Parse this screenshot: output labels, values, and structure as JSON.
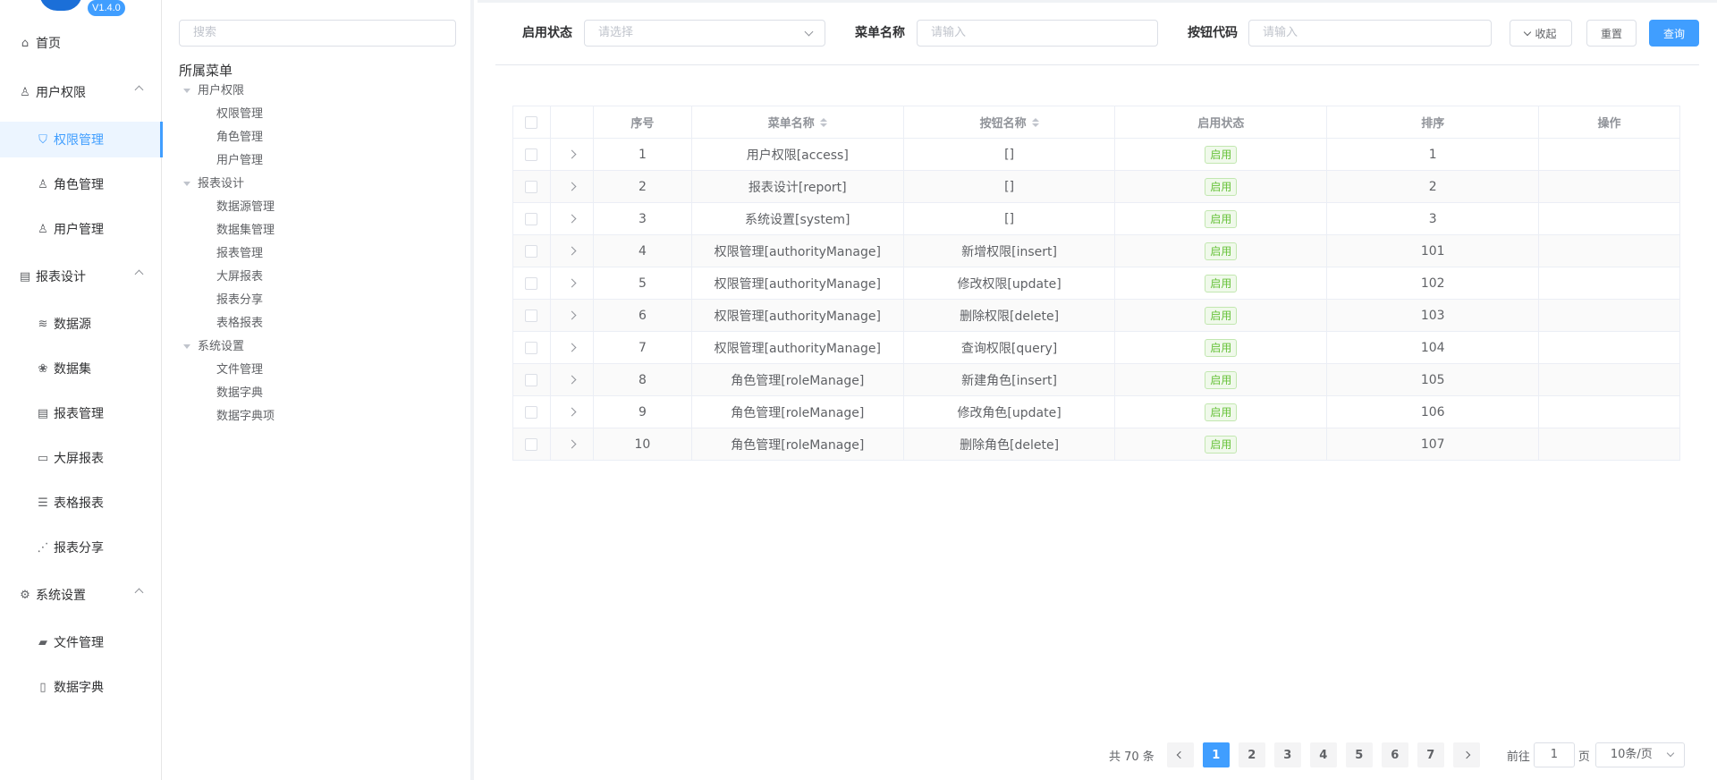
{
  "app": {
    "version": "V1.4.0"
  },
  "sidebar": {
    "items": [
      {
        "label": "首页",
        "icon": "home-icon",
        "level": 0
      },
      {
        "label": "用户权限",
        "icon": "user-icon",
        "level": 0,
        "expanded": true
      },
      {
        "label": "权限管理",
        "icon": "shield-icon",
        "level": 1,
        "active": true
      },
      {
        "label": "角色管理",
        "icon": "user-icon",
        "level": 1
      },
      {
        "label": "用户管理",
        "icon": "user-icon",
        "level": 1
      },
      {
        "label": "报表设计",
        "icon": "report-icon",
        "level": 0,
        "expanded": true
      },
      {
        "label": "数据源",
        "icon": "database-icon",
        "level": 1
      },
      {
        "label": "数据集",
        "icon": "dataset-icon",
        "level": 1
      },
      {
        "label": "报表管理",
        "icon": "report-icon",
        "level": 1
      },
      {
        "label": "大屏报表",
        "icon": "screen-icon",
        "level": 1
      },
      {
        "label": "表格报表",
        "icon": "list-icon",
        "level": 1
      },
      {
        "label": "报表分享",
        "icon": "share-icon",
        "level": 1
      },
      {
        "label": "系统设置",
        "icon": "gear-icon",
        "level": 0,
        "expanded": true
      },
      {
        "label": "文件管理",
        "icon": "folder-icon",
        "level": 1
      },
      {
        "label": "数据字典",
        "icon": "document-icon",
        "level": 1
      }
    ]
  },
  "tree": {
    "search_placeholder": "搜索",
    "title": "所属菜单",
    "nodes": [
      {
        "label": "用户权限",
        "level": 0
      },
      {
        "label": "权限管理",
        "level": 1
      },
      {
        "label": "角色管理",
        "level": 1
      },
      {
        "label": "用户管理",
        "level": 1
      },
      {
        "label": "报表设计",
        "level": 0
      },
      {
        "label": "数据源管理",
        "level": 1
      },
      {
        "label": "数据集管理",
        "level": 1
      },
      {
        "label": "报表管理",
        "level": 1
      },
      {
        "label": "大屏报表",
        "level": 1
      },
      {
        "label": "报表分享",
        "level": 1
      },
      {
        "label": "表格报表",
        "level": 1
      },
      {
        "label": "系统设置",
        "level": 0
      },
      {
        "label": "文件管理",
        "level": 1
      },
      {
        "label": "数据字典",
        "level": 1
      },
      {
        "label": "数据字典项",
        "level": 1
      }
    ]
  },
  "filters": {
    "status_label": "启用状态",
    "status_placeholder": "请选择",
    "menu_label": "菜单名称",
    "menu_placeholder": "请输入",
    "code_label": "按钮代码",
    "code_placeholder": "请输入",
    "collapse_label": "收起",
    "reset_label": "重置",
    "query_label": "查询"
  },
  "table": {
    "headers": [
      "",
      "",
      "序号",
      "菜单名称",
      "按钮名称",
      "启用状态",
      "排序",
      "操作"
    ],
    "rows": [
      {
        "no": "1",
        "menu": "用户权限[access]",
        "button": "[]",
        "status": "启用",
        "sort": "1"
      },
      {
        "no": "2",
        "menu": "报表设计[report]",
        "button": "[]",
        "status": "启用",
        "sort": "2"
      },
      {
        "no": "3",
        "menu": "系统设置[system]",
        "button": "[]",
        "status": "启用",
        "sort": "3"
      },
      {
        "no": "4",
        "menu": "权限管理[authorityManage]",
        "button": "新增权限[insert]",
        "status": "启用",
        "sort": "101"
      },
      {
        "no": "5",
        "menu": "权限管理[authorityManage]",
        "button": "修改权限[update]",
        "status": "启用",
        "sort": "102"
      },
      {
        "no": "6",
        "menu": "权限管理[authorityManage]",
        "button": "删除权限[delete]",
        "status": "启用",
        "sort": "103"
      },
      {
        "no": "7",
        "menu": "权限管理[authorityManage]",
        "button": "查询权限[query]",
        "status": "启用",
        "sort": "104"
      },
      {
        "no": "8",
        "menu": "角色管理[roleManage]",
        "button": "新建角色[insert]",
        "status": "启用",
        "sort": "105"
      },
      {
        "no": "9",
        "menu": "角色管理[roleManage]",
        "button": "修改角色[update]",
        "status": "启用",
        "sort": "106"
      },
      {
        "no": "10",
        "menu": "角色管理[roleManage]",
        "button": "删除角色[delete]",
        "status": "启用",
        "sort": "107"
      }
    ]
  },
  "pagination": {
    "total": "共 70 条",
    "pages": [
      "1",
      "2",
      "3",
      "4",
      "5",
      "6",
      "7"
    ],
    "current": "1",
    "goto_label": "前往",
    "goto_value": "1",
    "page_suffix": "页",
    "page_size": "10条/页"
  },
  "colors": {
    "primary": "#409eff",
    "success": "#67c23a",
    "logo": "#1b6fd8"
  }
}
